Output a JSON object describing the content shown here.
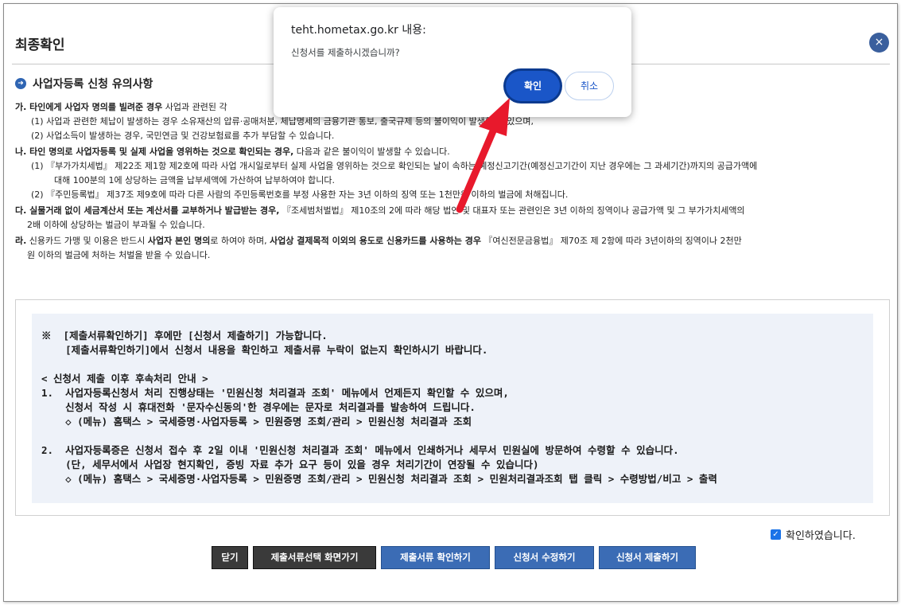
{
  "page": {
    "title": "최종확인",
    "close_icon": "×"
  },
  "notices": {
    "section_title": "사업자등록 신청 유의사항",
    "ga": {
      "lead_bold": "가. 타인에게 사업자 명의를 빌려준 경우",
      "lead_rest": " 사업과 관련된 각",
      "items": [
        "(1) 사업과 관련한 체납이 발생하는 경우 소유재산의 압류·공매처분, 체납명세의 금융기관 통보, 출국규제 등의 불이익이 발생할 수 있으며,",
        "(2) 사업소득이 발생하는 경우, 국민연금 및 건강보험료를 추가 부담할 수 있습니다."
      ]
    },
    "na": {
      "lead_bold": "나. 타인 명의로 사업자등록 및 실제 사업을 영위하는 것으로 확인되는 경우,",
      "lead_rest": " 다음과 같은 불이익이 발생할 수 있습니다.",
      "items": [
        "(1) 『부가가치세법』 제22조 제1항 제2호에 따라 사업 개시일로부터 실제 사업을 영위하는 것으로 확인되는 날이 속하는 예정신고기간(예정신고기간이 지난 경우에는 그 과세기간)까지의 공급가액에",
        "대해 100분의 1에 상당하는 금액을 납부세액에 가산하여 납부하여야 합니다.",
        "(2) 『주민등록법』 제37조 제9호에 따라 다른 사람의 주민등록번호를 부정 사용한 자는 3년 이하의 징역 또는 1천만원 이하의 벌금에 처해집니다."
      ]
    },
    "da": {
      "lead_bold": "다. 실물거래 없이 세금계산서 또는 계산서를 교부하거나 발급받는 경우,",
      "lead_rest": " 『조세범처벌법』 제10조의 2에 따라 해당 법인 및 대표자 또는 관련인은 3년 이하의 징역이나 공급가액 및 그 부가가치세액의",
      "cont": "2배 이하에 상당하는 벌금이 부과될 수 있습니다."
    },
    "ra": {
      "lead_prefix": "라.",
      "lead_part1": " 신용카드 가맹 및 이용은 반드시 ",
      "bold1": "사업자 본인 명의",
      "lead_part2": "로 하여야 하며, ",
      "bold2": "사업상 결제목적 이외의 용도로 신용카드를 사용하는 경우",
      "lead_part3": " 『여신전문금융법』 제70조 제 2항에 따라 3년이하의 징역이나 2천만",
      "cont": "원 이하의 벌금에 처하는 처벌을 받을 수 있습니다."
    }
  },
  "info_box": {
    "lines": [
      "※  [제출서류확인하기] 후에만 [신청서 제출하기] 가능합니다.",
      "    [제출서류확인하기]에서 신청서 내용을 확인하고 제출서류 누락이 없는지 확인하시기 바랍니다.",
      "",
      "< 신청서 제출 이후 후속처리 안내 >",
      "1.  사업자등록신청서 처리 진행상태는 '민원신청 처리결과 조회' 메뉴에서 언제든지 확인할 수 있으며,",
      "    신청서 작성 시 휴대전화 '문자수신동의'한 경우에는 문자로 처리결과를 발송하여 드립니다.",
      "    ◇ (메뉴) 홈택스 > 국세증명·사업자등록 > 민원증명 조회/관리 > 민원신청 처리결과 조회",
      "",
      "2.  사업자등록증은 신청서 접수 후 2일 이내 '민원신청 처리결과 조회' 메뉴에서 인쇄하거나 세무서 민원실에 방문하여 수령할 수 있습니다.",
      "    (단, 세무서에서 사업장 현지확인, 증빙 자료 추가 요구 등이 있을 경우 처리기간이 연장될 수 있습니다)",
      "    ◇ (메뉴) 홈택스 > 국세증명·사업자등록 > 민원증명 조회/관리 > 민원신청 처리결과 조회 > 민원처리결과조회 탭 클릭 > 수령방법/비고 > 출력"
    ]
  },
  "confirm": {
    "label": "확인하였습니다.",
    "checked": true
  },
  "buttons": {
    "close": "닫기",
    "go_doc_select": "제출서류선택 화면가기",
    "check_docs": "제출서류 확인하기",
    "edit_application": "신청서 수정하기",
    "submit_application": "신청서 제출하기"
  },
  "dialog": {
    "origin": "teht.hometax.go.kr 내용:",
    "message": "신청서를 제출하시겠습니까?",
    "ok": "확인",
    "cancel": "취소"
  },
  "colors": {
    "annotation_arrow": "#e8192c",
    "primary_button": "#3b6cb5",
    "dark_button": "#3a3a3a",
    "dialog_ok": "#1a56c8",
    "info_background": "#eef2f9"
  }
}
